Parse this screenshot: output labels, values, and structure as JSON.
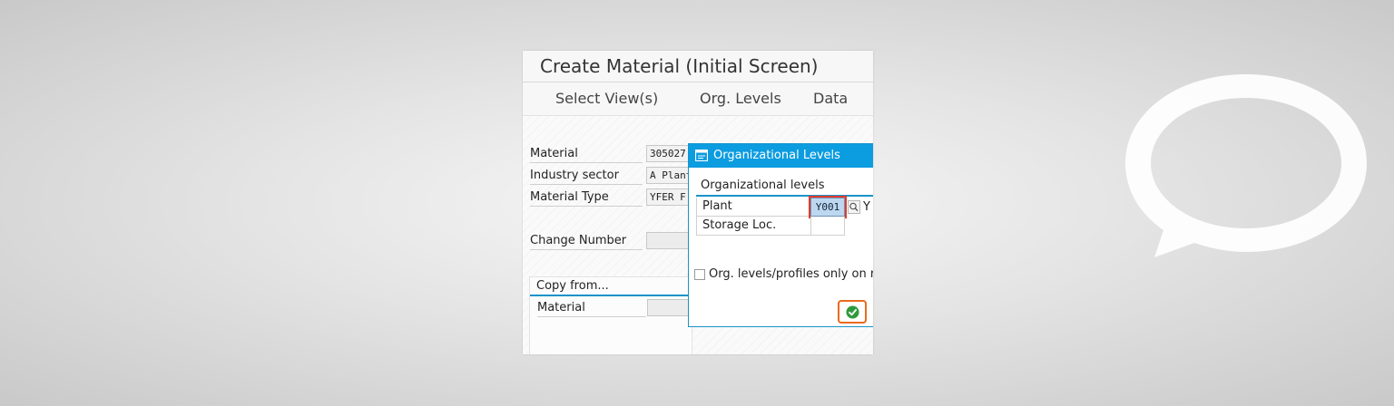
{
  "window": {
    "title": "Create Material (Initial Screen)"
  },
  "toolbar": {
    "select_views": "Select View(s)",
    "org_levels": "Org. Levels",
    "data": "Data"
  },
  "form": {
    "material_label": "Material",
    "material_value": "305027",
    "industry_sector_label": "Industry sector",
    "industry_sector_value": "A Plant",
    "material_type_label": "Material Type",
    "material_type_value": "YFER F",
    "change_number_label": "Change Number",
    "change_number_value": ""
  },
  "copy_from": {
    "title": "Copy from...",
    "material_label": "Material",
    "material_value": ""
  },
  "dialog": {
    "title": "Organizational Levels",
    "group_header": "Organizational levels",
    "plant_label": "Plant",
    "plant_value": "Y001",
    "plant_desc": "Y",
    "storage_loc_label": "Storage Loc.",
    "storage_loc_value": "",
    "checkbox_label": "Org. levels/profiles only on r",
    "checkbox_checked": false
  },
  "colors": {
    "dialog_header": "#0c9ce0",
    "accent_line": "#1a93c9",
    "highlight_red": "#e23a2c",
    "highlight_orange": "#e96a1c",
    "continue_green": "#2e9a3b",
    "selected_input": "#bcd7ef"
  },
  "icons": {
    "dialog": "dialog-window-icon",
    "search_help": "search-help-icon",
    "continue": "checkmark-circle-icon",
    "background": "speech-bubble-icon"
  }
}
